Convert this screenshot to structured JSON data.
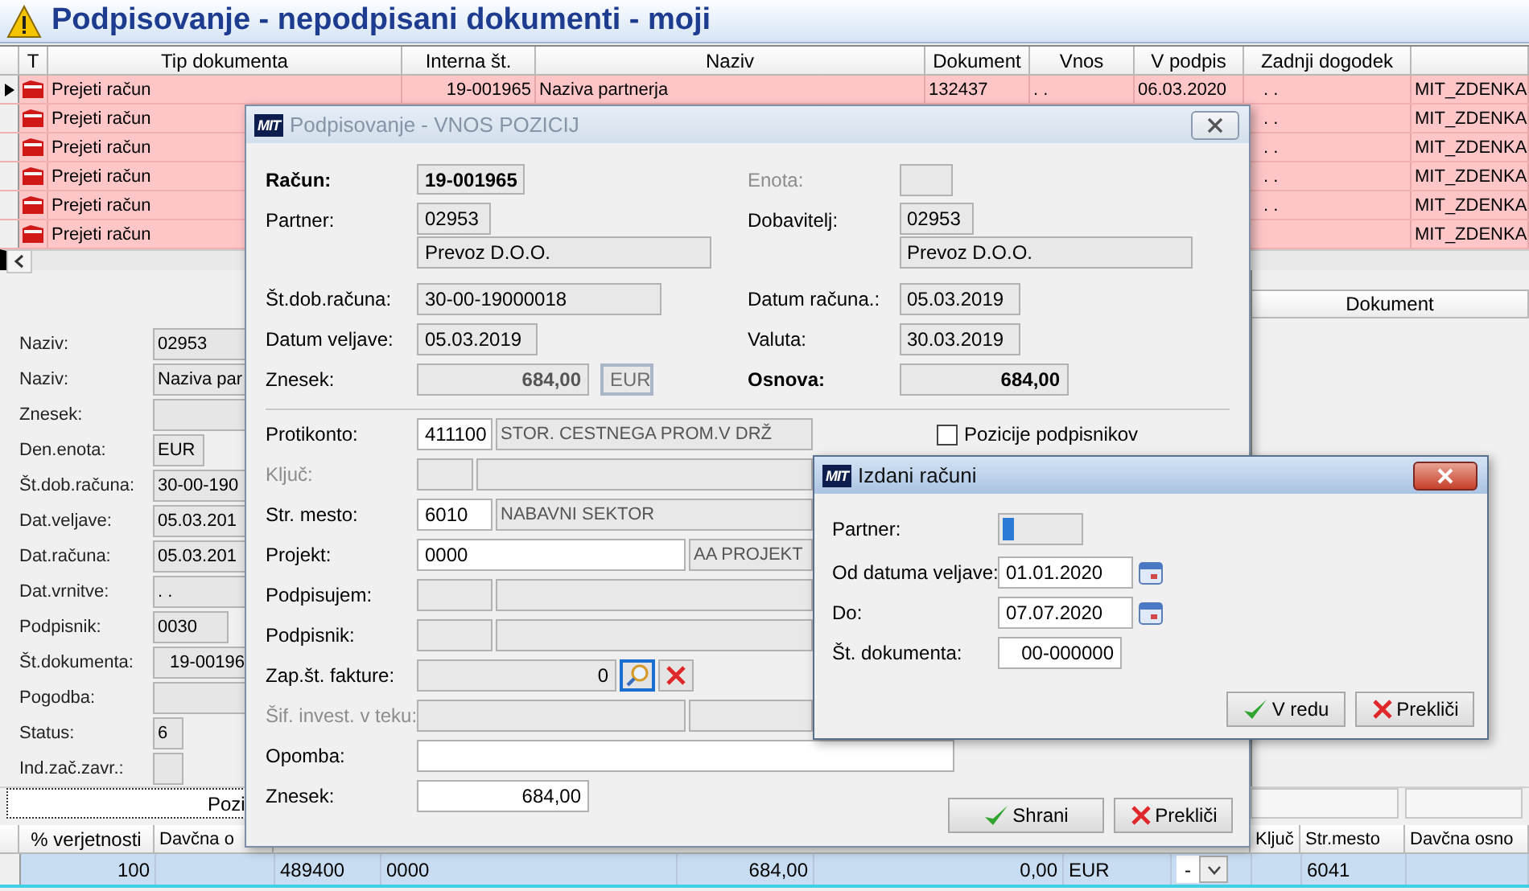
{
  "window": {
    "title": "Podpisovanje - nepodpisani dokumenti - moji"
  },
  "documents": {
    "columns": [
      "T",
      "Tip dokumenta",
      "Interna št.",
      "Naziv",
      "Dokument",
      "Vnos",
      "V podpis",
      "Zadnji dogodek"
    ],
    "rows": [
      {
        "selected": true,
        "tip": "Prejeti račun",
        "interna": "19-001965",
        "naziv": "Naziva partnerja",
        "dokument": "132437",
        "vnos": ". .",
        "v_podpis": "06.03.2020",
        "zadnji_dogodek": ". .",
        "column_9": "MIT_ZDENKA"
      },
      {
        "selected": false,
        "tip": "Prejeti račun",
        "zadnji_dogodek": ". .",
        "column_9": "MIT_ZDENKA"
      },
      {
        "selected": false,
        "tip": "Prejeti račun",
        "zadnji_dogodek": ". .",
        "column_9": "MIT_ZDENKA"
      },
      {
        "selected": false,
        "tip": "Prejeti račun",
        "zadnji_dogodek": ". .",
        "column_9": "MIT_ZDENKA"
      },
      {
        "selected": false,
        "tip": "Prejeti račun",
        "zadnji_dogodek": ". .",
        "column_9": "MIT_ZDENKA"
      },
      {
        "selected": false,
        "tip": "Prejeti račun",
        "column_9": "MIT_ZDENKA"
      }
    ]
  },
  "details": {
    "fields": [
      {
        "kind": "wide",
        "label": "Naziv:",
        "value": "02953"
      },
      {
        "kind": "wide",
        "label": "Naziv:",
        "value": "Naziva par"
      },
      {
        "kind": "wide",
        "label": "Znesek:"
      },
      {
        "kind": "short",
        "label": "Den.enota:",
        "value": "EUR"
      },
      {
        "kind": "wide",
        "label": "Št.dob.računa:",
        "value": "30-00-190"
      },
      {
        "kind": "wide",
        "label": "Dat.veljave:",
        "value": "05.03.201"
      },
      {
        "kind": "wide",
        "label": "Dat.računa:",
        "value": "05.03.201"
      },
      {
        "kind": "wide",
        "label": "Dat.vrnitve:",
        "value": ". ."
      },
      {
        "kind": "medium",
        "label": "Podpisnik:",
        "value": "0030"
      },
      {
        "kind": "number",
        "label": "Št.dokumenta:",
        "value": "19-00196"
      },
      {
        "kind": "wide",
        "label": "Pogodba:"
      },
      {
        "kind": "tiny",
        "label": "Status:",
        "value": "6"
      },
      {
        "kind": "tiny",
        "label": "Ind.zač.zavr.:"
      }
    ],
    "side_header": "Dokument"
  },
  "tabs": [
    {
      "label": "Pozi",
      "selected": true
    }
  ],
  "positions": {
    "columns": [
      "% verjetnosti",
      "Davčna o",
      "Ključ",
      "Str.mesto",
      "Davčna osno"
    ],
    "rows": [
      {
        "verjetnost": "100",
        "column_3": "489400",
        "column_4": "0000",
        "column_6": "684,00",
        "column_7": "0,00",
        "column_8": "EUR",
        "column_9": "-",
        "str_mesto": "6041"
      }
    ]
  },
  "vnos_dialog": {
    "logo": "MIT",
    "title": "Podpisovanje - VNOS POZICIJ",
    "racun": {
      "label": "Račun:",
      "value": "19-001965"
    },
    "enota": {
      "label": "Enota:",
      "disabled": true
    },
    "partner": {
      "label": "Partner:",
      "code": "02953",
      "name": "Prevoz D.O.O."
    },
    "dobavitelj": {
      "label": "Dobavitelj:",
      "code": "02953",
      "name": "Prevoz D.O.O."
    },
    "left_fields": [
      {
        "label": "Št.dob.računa:",
        "value": "30-00-19000018"
      },
      {
        "label": "Datum veljave:",
        "value": "05.03.2019"
      }
    ],
    "right_fields": [
      {
        "label": "Datum računa.:",
        "value": "05.03.2019"
      },
      {
        "label": "Valuta:",
        "value": "30.03.2019"
      }
    ],
    "znesek": {
      "label": "Znesek:",
      "value": "684,00",
      "currency": "EUR"
    },
    "osnova": {
      "label": "Osnova:",
      "value": "684,00"
    },
    "pozicije": {
      "label": "Pozicije podpisnikov",
      "checked": false
    },
    "lines": [
      {
        "kind": "pair",
        "label": "Protikonto:",
        "disabled": false,
        "code": "411100",
        "name": "STOR. CESTNEGA PROM.V DRŽ",
        "editable": true
      },
      {
        "kind": "short",
        "label": "Ključ:",
        "disabled": true,
        "editable": false
      },
      {
        "kind": "pair",
        "label": "Str. mesto:",
        "disabled": false,
        "code": "6010",
        "name": "NABAVNI SEKTOR",
        "editable": true
      },
      {
        "kind": "wide",
        "label": "Projekt:",
        "disabled": false,
        "code": "0000",
        "name": "AA PROJEKT",
        "editable": true
      },
      {
        "kind": "pair",
        "label": "Podpisujem:",
        "disabled": false,
        "editable": false
      },
      {
        "kind": "pair",
        "label": "Podpisnik:",
        "disabled": false,
        "editable": false
      },
      {
        "kind": "lookup",
        "label": "Zap.št. fakture:",
        "disabled": false,
        "value": "0"
      },
      {
        "kind": "wide",
        "label": "Šif. invest. v teku:",
        "disabled": true,
        "editable": false
      },
      {
        "kind": "text",
        "label": "Opomba:",
        "disabled": false
      },
      {
        "kind": "amount",
        "label": "Znesek:",
        "disabled": false,
        "value": "684,00"
      }
    ],
    "buttons": [
      {
        "kind": "ok",
        "label": "Shrani"
      },
      {
        "kind": "cancel",
        "label": "Prekliči"
      }
    ]
  },
  "izdani_dialog": {
    "logo": "MIT",
    "title": "Izdani računi",
    "fields": [
      {
        "kind": "selection",
        "label": "Partner:"
      },
      {
        "kind": "date",
        "label": "Od datuma veljave:",
        "value": "01.01.2020"
      },
      {
        "kind": "date",
        "label": "Do:",
        "value": "07.07.2020"
      },
      {
        "kind": "number",
        "label": "Št. dokumenta:",
        "value": "00-000000"
      }
    ],
    "buttons": [
      {
        "kind": "ok",
        "label": "V redu"
      },
      {
        "kind": "cancel",
        "label": "Prekliči"
      }
    ]
  }
}
